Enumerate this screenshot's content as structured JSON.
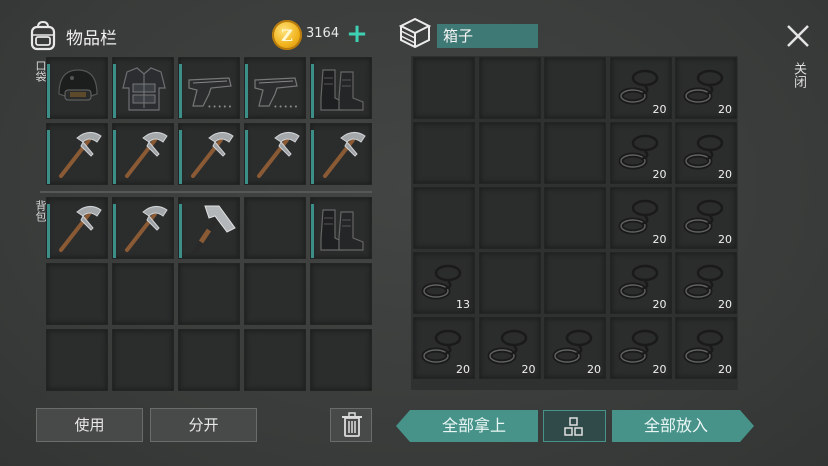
{
  "inventory": {
    "title": "物品栏",
    "coins": "3164",
    "pocket_label": "口袋",
    "backpack_label": "背包",
    "pocket_slots": [
      {
        "icon": "helmet-icon"
      },
      {
        "icon": "body-armor-icon"
      },
      {
        "icon": "pistol-icon"
      },
      {
        "icon": "pistol-icon"
      },
      {
        "icon": "boots-icon"
      },
      {
        "icon": "pickaxe-icon"
      },
      {
        "icon": "pickaxe-icon"
      },
      {
        "icon": "pickaxe-icon"
      },
      {
        "icon": "pickaxe-icon"
      },
      {
        "icon": "pickaxe-icon"
      }
    ],
    "backpack_slots": [
      {
        "icon": "pickaxe-icon"
      },
      {
        "icon": "pickaxe-icon"
      },
      {
        "icon": "hammer-icon"
      },
      {
        "icon": ""
      },
      {
        "icon": "boots-icon"
      },
      {
        "icon": ""
      },
      {
        "icon": ""
      },
      {
        "icon": ""
      },
      {
        "icon": ""
      },
      {
        "icon": ""
      },
      {
        "icon": ""
      },
      {
        "icon": ""
      },
      {
        "icon": ""
      },
      {
        "icon": ""
      },
      {
        "icon": ""
      }
    ]
  },
  "chest": {
    "title": "箱子",
    "slots": [
      {
        "icon": "",
        "qty": ""
      },
      {
        "icon": "",
        "qty": ""
      },
      {
        "icon": "",
        "qty": ""
      },
      {
        "icon": "rope-icon",
        "qty": "20"
      },
      {
        "icon": "rope-icon",
        "qty": "20"
      },
      {
        "icon": "",
        "qty": ""
      },
      {
        "icon": "",
        "qty": ""
      },
      {
        "icon": "",
        "qty": ""
      },
      {
        "icon": "rope-icon",
        "qty": "20"
      },
      {
        "icon": "rope-icon",
        "qty": "20"
      },
      {
        "icon": "",
        "qty": ""
      },
      {
        "icon": "",
        "qty": ""
      },
      {
        "icon": "",
        "qty": ""
      },
      {
        "icon": "rope-icon",
        "qty": "20"
      },
      {
        "icon": "rope-icon",
        "qty": "20"
      },
      {
        "icon": "rope-icon",
        "qty": "13"
      },
      {
        "icon": "",
        "qty": ""
      },
      {
        "icon": "",
        "qty": ""
      },
      {
        "icon": "rope-icon",
        "qty": "20"
      },
      {
        "icon": "rope-icon",
        "qty": "20"
      },
      {
        "icon": "rope-icon",
        "qty": "20"
      },
      {
        "icon": "rope-icon",
        "qty": "20"
      },
      {
        "icon": "rope-icon",
        "qty": "20"
      },
      {
        "icon": "rope-icon",
        "qty": "20"
      },
      {
        "icon": "rope-icon",
        "qty": "20"
      }
    ]
  },
  "close_label": "关闭",
  "buttons": {
    "use": "使用",
    "split": "分开",
    "take_all": "全部拿上",
    "put_all": "全部放入"
  },
  "colors": {
    "accent": "#47938a",
    "coin": "#f0b21c",
    "plus": "#3fd0b3"
  }
}
